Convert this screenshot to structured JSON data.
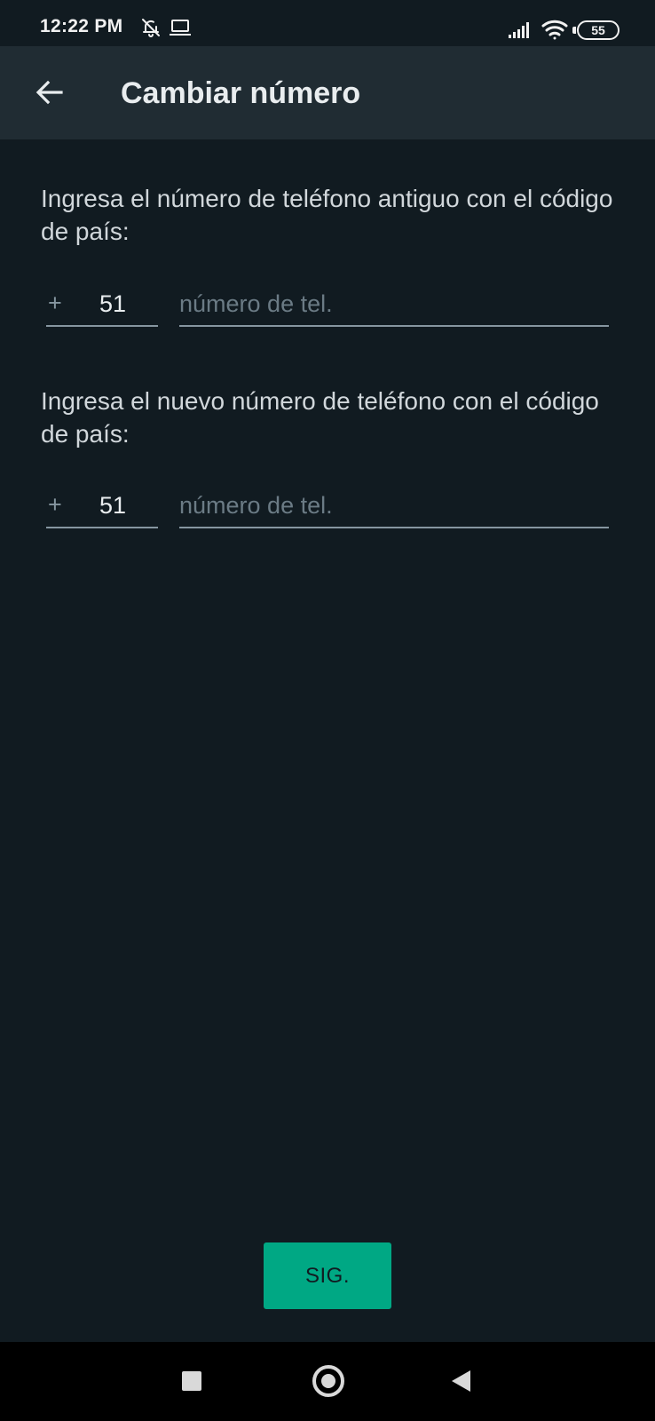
{
  "status_bar": {
    "time": "12:22 PM",
    "battery": "55",
    "icons": [
      "bell-off-icon",
      "laptop-icon",
      "signal-icon",
      "wifi-icon",
      "battery-icon"
    ]
  },
  "app_bar": {
    "title": "Cambiar número",
    "back_icon": "arrow-left-icon"
  },
  "old_number": {
    "instruction": "Ingresa el número de teléfono antiguo con el código de país:",
    "plus": "+",
    "country_code": "51",
    "placeholder": "número de tel."
  },
  "new_number": {
    "instruction": "Ingresa el nuevo número de teléfono con el código de país:",
    "plus": "+",
    "country_code": "51",
    "placeholder": "número de tel."
  },
  "next_button": {
    "label": "SIG."
  },
  "colors": {
    "background": "#111b21",
    "app_bar": "#202c33",
    "accent": "#00a884",
    "underline": "#8696a0"
  },
  "nav_bar": {
    "icons": [
      "recents-square-icon",
      "home-circle-icon",
      "back-triangle-icon"
    ]
  }
}
